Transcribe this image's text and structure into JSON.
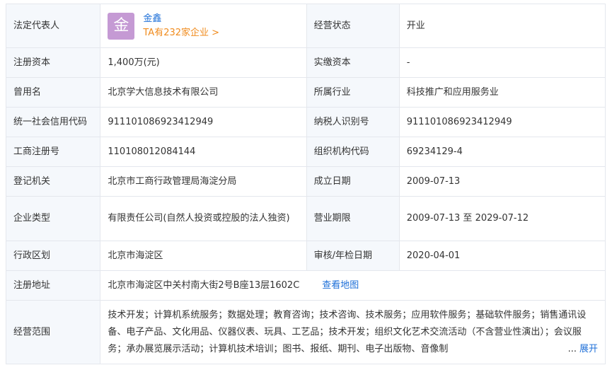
{
  "rows": {
    "legal_rep": {
      "label": "法定代表人",
      "avatar_char": "金",
      "name": "金鑫",
      "company_count": "TA有232家企业 >",
      "status_label": "经营状态",
      "status_value": "开业"
    },
    "reg_capital": {
      "label": "注册资本",
      "value": "1,400万(元)",
      "label2": "实缴资本",
      "value2": "-"
    },
    "former_name": {
      "label": "曾用名",
      "value": "北京学大信息技术有限公司",
      "label2": "所属行业",
      "value2": "科技推广和应用服务业"
    },
    "credit_code": {
      "label": "统一社会信用代码",
      "value": "911101086923412949",
      "label2": "纳税人识别号",
      "value2": "911101086923412949"
    },
    "biz_reg_no": {
      "label": "工商注册号",
      "value": "110108012084144",
      "label2": "组织机构代码",
      "value2": "69234129-4"
    },
    "reg_authority": {
      "label": "登记机关",
      "value": "北京市工商行政管理局海淀分局",
      "label2": "成立日期",
      "value2": "2009-07-13"
    },
    "company_type": {
      "label": "企业类型",
      "value": "有限责任公司(自然人投资或控股的法人独资)",
      "label2": "营业期限",
      "value2": "2009-07-13 至 2029-07-12"
    },
    "district": {
      "label": "行政区划",
      "value": "北京市海淀区",
      "label2": "审核/年检日期",
      "value2": "2020-04-01"
    },
    "address": {
      "label": "注册地址",
      "value": "北京市海淀区中关村南大街2号B座13层1602C",
      "map_link": "查看地图"
    },
    "scope": {
      "label": "经营范围",
      "value": "技术开发；计算机系统服务；数据处理；教育咨询；技术咨询、技术服务；应用软件服务；基础软件服务；销售通讯设备、电子产品、文化用品、仪器仪表、玩具、工艺品；技术开发；组织文化艺术交流活动（不含营业性演出）；会议服务；承办展览展示活动；计算机技术培训；图书、报纸、期刊、电子出版物、音像制",
      "ellipsis": "...",
      "expand": "展开"
    }
  }
}
